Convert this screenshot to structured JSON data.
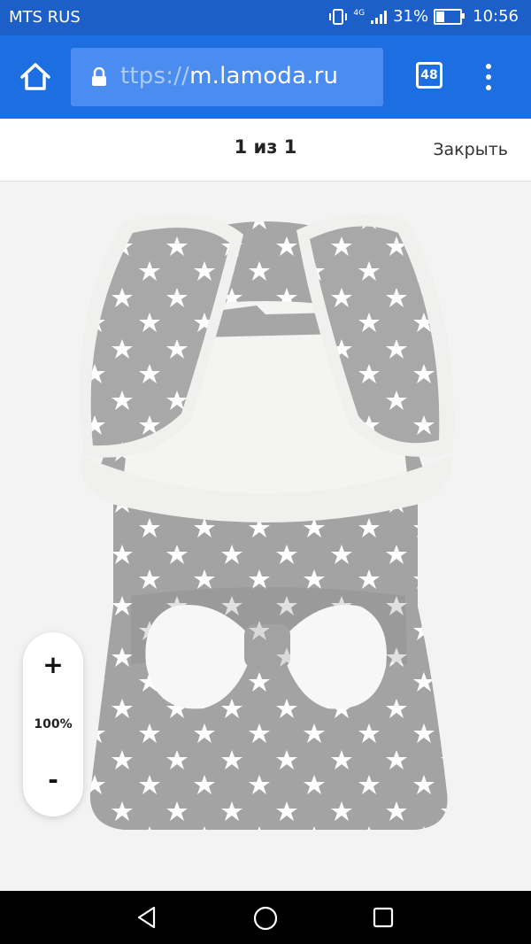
{
  "status_bar": {
    "carrier": "MTS RUS",
    "network": "4G",
    "battery": "31%",
    "time": "10:56"
  },
  "browser": {
    "url_faded": "ttps://",
    "url_domain": "m.lamoda.ru",
    "tab_count": "48"
  },
  "viewer": {
    "counter": "1 из 1",
    "close_label": "Закрыть"
  },
  "zoom": {
    "in_label": "+",
    "level": "100%",
    "out_label": "-"
  },
  "colors": {
    "statusbar": "#1c5fc8",
    "toolbar": "#1d6ee0",
    "urlbar": "#4a8cf0",
    "fabric": "#a3a3a3",
    "fur": "#f4f4f2"
  }
}
